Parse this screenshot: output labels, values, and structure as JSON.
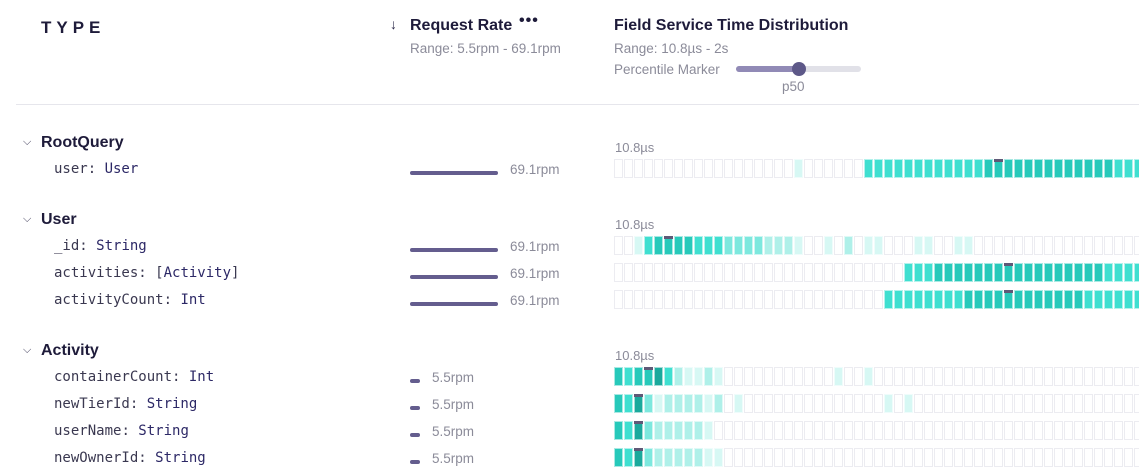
{
  "header": {
    "column_type": "TYPE",
    "sort_arrow": "↓",
    "request_rate": {
      "title": "Request Rate",
      "menu": "•••",
      "range": "Range: 5.5rpm - 69.1rpm"
    },
    "distribution": {
      "title": "Field Service Time Distribution",
      "range": "Range: 10.8µs - 2s",
      "marker_label": "Percentile Marker",
      "marker_value": "p50",
      "marker_fraction": 0.5
    }
  },
  "colors": {
    "heat_levels": [
      "#ffffff",
      "#d7f8f4",
      "#aff0e9",
      "#7de8de",
      "#3fdfd0",
      "#27c9ba",
      "#1aa99c"
    ],
    "rate_bar": "#645d8e",
    "marker": "#5f5977"
  },
  "icons": {
    "expand": "chevron-down-icon"
  },
  "groups": [
    {
      "name": "RootQuery",
      "chevron": "⌵",
      "min_label": "10.8µs",
      "fields": [
        {
          "name": "user",
          "type": "User",
          "wrapped": false,
          "rate": "69.1rpm",
          "rate_value": 69.1,
          "heat": [
            0,
            0,
            0,
            0,
            0,
            0,
            0,
            0,
            0,
            0,
            0,
            0,
            0,
            0,
            0,
            0,
            0,
            0,
            1,
            0,
            0,
            0,
            0,
            0,
            0,
            4,
            4,
            4,
            4,
            4,
            4,
            4,
            4,
            4,
            4,
            4,
            4,
            5,
            5,
            5,
            5,
            5,
            5,
            5,
            5,
            5,
            5,
            5,
            5,
            5,
            4,
            4,
            4,
            4,
            4,
            4,
            4,
            4
          ],
          "marker_index": 38
        }
      ]
    },
    {
      "name": "User",
      "chevron": "⌵",
      "min_label": "10.8µs",
      "fields": [
        {
          "name": "_id",
          "type": "String",
          "wrapped": false,
          "rate": "69.1rpm",
          "rate_value": 69.1,
          "heat": [
            0,
            0,
            1,
            4,
            5,
            5,
            5,
            5,
            4,
            4,
            4,
            3,
            3,
            3,
            3,
            2,
            2,
            2,
            1,
            0,
            0,
            1,
            0,
            2,
            0,
            1,
            1,
            0,
            0,
            0,
            1,
            1,
            0,
            0,
            1,
            1,
            0,
            0,
            0,
            0,
            0,
            0,
            0,
            0,
            0,
            0,
            0,
            0,
            0,
            0,
            0,
            0,
            0,
            0,
            0,
            0,
            0,
            0
          ],
          "marker_index": 5
        },
        {
          "name": "activities",
          "type": "Activity",
          "wrapped": true,
          "rate": "69.1rpm",
          "rate_value": 69.1,
          "heat": [
            0,
            0,
            0,
            0,
            0,
            0,
            0,
            0,
            0,
            0,
            0,
            0,
            0,
            0,
            0,
            0,
            0,
            0,
            0,
            0,
            0,
            0,
            0,
            0,
            0,
            0,
            0,
            0,
            0,
            4,
            4,
            4,
            5,
            5,
            5,
            5,
            5,
            5,
            5,
            5,
            5,
            5,
            5,
            5,
            5,
            5,
            5,
            5,
            5,
            4,
            4,
            4,
            4,
            4,
            4,
            4,
            4,
            4
          ],
          "marker_index": 39
        },
        {
          "name": "activityCount",
          "type": "Int",
          "wrapped": false,
          "rate": "69.1rpm",
          "rate_value": 69.1,
          "heat": [
            0,
            0,
            0,
            0,
            0,
            0,
            0,
            0,
            0,
            0,
            0,
            0,
            0,
            0,
            0,
            0,
            0,
            0,
            0,
            0,
            0,
            0,
            0,
            0,
            0,
            0,
            0,
            4,
            4,
            4,
            4,
            4,
            4,
            4,
            4,
            5,
            5,
            5,
            5,
            5,
            5,
            5,
            5,
            5,
            5,
            5,
            5,
            4,
            4,
            4,
            4,
            4,
            4,
            4,
            4,
            4,
            4,
            4
          ],
          "marker_index": 39
        }
      ]
    },
    {
      "name": "Activity",
      "chevron": "⌵",
      "min_label": "10.8µs",
      "fields": [
        {
          "name": "containerCount",
          "type": "Int",
          "wrapped": false,
          "rate": "5.5rpm",
          "rate_value": 5.5,
          "heat": [
            5,
            4,
            5,
            5,
            6,
            4,
            2,
            1,
            1,
            2,
            1,
            0,
            0,
            0,
            0,
            0,
            0,
            0,
            0,
            0,
            0,
            0,
            1,
            0,
            0,
            1,
            0,
            0,
            0,
            0,
            0,
            0,
            0,
            0,
            0,
            0,
            0,
            0,
            0,
            0,
            0,
            0,
            0,
            0,
            0,
            0,
            0,
            0,
            0,
            0,
            0,
            0,
            0,
            0,
            0,
            0,
            0,
            0
          ],
          "marker_index": 3
        },
        {
          "name": "newTierId",
          "type": "String",
          "wrapped": false,
          "rate": "5.5rpm",
          "rate_value": 5.5,
          "heat": [
            5,
            4,
            6,
            3,
            1,
            2,
            2,
            2,
            2,
            1,
            2,
            0,
            1,
            0,
            0,
            0,
            0,
            0,
            0,
            0,
            0,
            0,
            0,
            0,
            0,
            0,
            0,
            1,
            0,
            1,
            0,
            0,
            0,
            0,
            0,
            0,
            0,
            0,
            0,
            0,
            0,
            0,
            0,
            0,
            0,
            0,
            0,
            0,
            0,
            0,
            0,
            0,
            0,
            0,
            0,
            0,
            0,
            0
          ],
          "marker_index": 2
        },
        {
          "name": "userName",
          "type": "String",
          "wrapped": false,
          "rate": "5.5rpm",
          "rate_value": 5.5,
          "heat": [
            5,
            4,
            6,
            3,
            2,
            2,
            2,
            2,
            2,
            1,
            0,
            0,
            0,
            0,
            0,
            0,
            0,
            0,
            0,
            0,
            0,
            0,
            0,
            0,
            0,
            0,
            0,
            0,
            0,
            0,
            0,
            0,
            0,
            0,
            0,
            0,
            0,
            0,
            0,
            0,
            0,
            0,
            0,
            0,
            0,
            0,
            0,
            0,
            0,
            0,
            0,
            0,
            0,
            0,
            0,
            0,
            0,
            0
          ],
          "marker_index": 2
        },
        {
          "name": "newOwnerId",
          "type": "String",
          "wrapped": false,
          "rate": "5.5rpm",
          "rate_value": 5.5,
          "heat": [
            5,
            4,
            6,
            3,
            2,
            2,
            2,
            2,
            2,
            1,
            1,
            0,
            0,
            0,
            0,
            0,
            0,
            0,
            0,
            0,
            0,
            0,
            0,
            0,
            0,
            0,
            0,
            0,
            0,
            0,
            0,
            0,
            0,
            0,
            0,
            0,
            0,
            0,
            0,
            0,
            0,
            0,
            0,
            0,
            0,
            0,
            0,
            0,
            0,
            0,
            0,
            0,
            0,
            0,
            0,
            0,
            0,
            0
          ],
          "marker_index": 2
        }
      ]
    }
  ]
}
